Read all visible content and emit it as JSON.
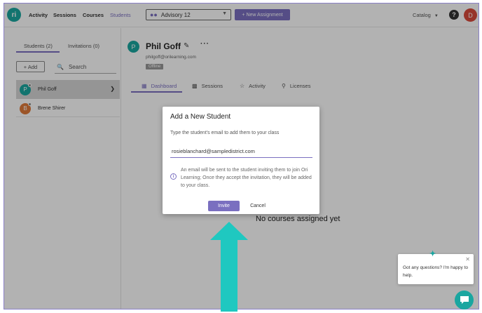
{
  "nav": {
    "logo": "ri",
    "links": [
      "Activity",
      "Sessions",
      "Courses",
      "Students"
    ],
    "class_select": "Advisory 12",
    "new_assignment": "+ New Assignment",
    "catalog": "Catalog",
    "help": "?",
    "user_initial": "D"
  },
  "left": {
    "tabs": [
      "Students (2)",
      "Invitations (0)"
    ],
    "add_label": "+ Add",
    "search_placeholder": "Search",
    "students": [
      {
        "initial": "P",
        "name": "Phil Goff",
        "color": "#1aa6a0"
      },
      {
        "initial": "B",
        "name": "Brene Shirer",
        "color": "#e07a3a"
      }
    ]
  },
  "profile": {
    "initial": "P",
    "name": "Phil Goff",
    "email": "philgoff@orilearning.com",
    "status": "Offline",
    "tabs": [
      "Dashboard",
      "Sessions",
      "Activity",
      "Licenses"
    ],
    "empty_message": "No courses assigned yet"
  },
  "modal": {
    "title": "Add a New Student",
    "prompt": "Type the student's email to add them to your class",
    "email_value": "rosieblanchard@sampledistrict.com",
    "info": "An email will be sent to the student inviting them to join Ori Learning; Once they accept the invitation, they will be added to your class.",
    "invite": "Invite",
    "cancel": "Cancel"
  },
  "chat": {
    "message": "Got any questions? I'm happy to help."
  },
  "colors": {
    "accent": "#7a6fc0",
    "teal": "#1aa6a0",
    "user_avatar": "#d84a3c"
  }
}
